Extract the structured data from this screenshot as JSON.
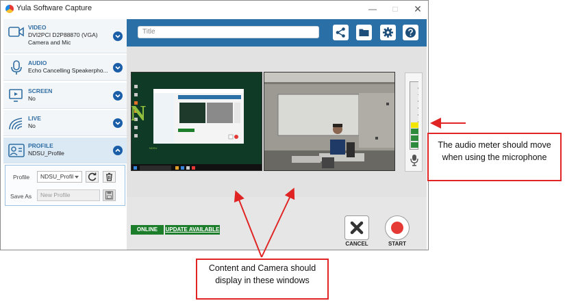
{
  "window": {
    "title": "Yula Software Capture",
    "minimize_icon": "minimize-icon",
    "maximize_icon": "maximize-icon",
    "close_icon": "close-icon"
  },
  "sidebar": {
    "items": [
      {
        "name": "VIDEO",
        "detail": "DVI2PCI D2P88870 (VGA)",
        "detail2": "Camera and Mic",
        "icon": "camera-icon"
      },
      {
        "name": "AUDIO",
        "detail": "Echo Cancelling Speakerpho...",
        "icon": "microphone-icon"
      },
      {
        "name": "SCREEN",
        "detail": "No",
        "icon": "screen-icon"
      },
      {
        "name": "LIVE",
        "detail": "No",
        "icon": "broadcast-icon"
      },
      {
        "name": "PROFILE",
        "detail": "NDSU_Profile",
        "icon": "profile-icon"
      }
    ],
    "profile_panel": {
      "profile_label": "Profile",
      "profile_value": "NDSU_Profil",
      "save_as_label": "Save As",
      "save_as_placeholder": "New Profile"
    }
  },
  "toolbar": {
    "title_placeholder": "Title",
    "buttons": [
      "share-icon",
      "folder-icon",
      "gear-icon",
      "help-icon"
    ]
  },
  "audio_meter": {
    "level_fraction": 0.42,
    "colors": {
      "green": "#2e8b3d",
      "yellow": "#f2e600",
      "empty": "#e9e9e9"
    }
  },
  "status": {
    "online": "ONLINE",
    "update": "UPDATE AVAILABLE"
  },
  "actions": {
    "cancel": "CANCEL",
    "start": "START"
  },
  "annotations": {
    "meter_note": "The audio meter should move when using the microphone",
    "window_note": "Content and Camera should display in these windows"
  },
  "colors": {
    "accent": "#2a6fa6",
    "status_green": "#1c7e2a",
    "callout_red": "#e02424",
    "record_red": "#e53935"
  }
}
